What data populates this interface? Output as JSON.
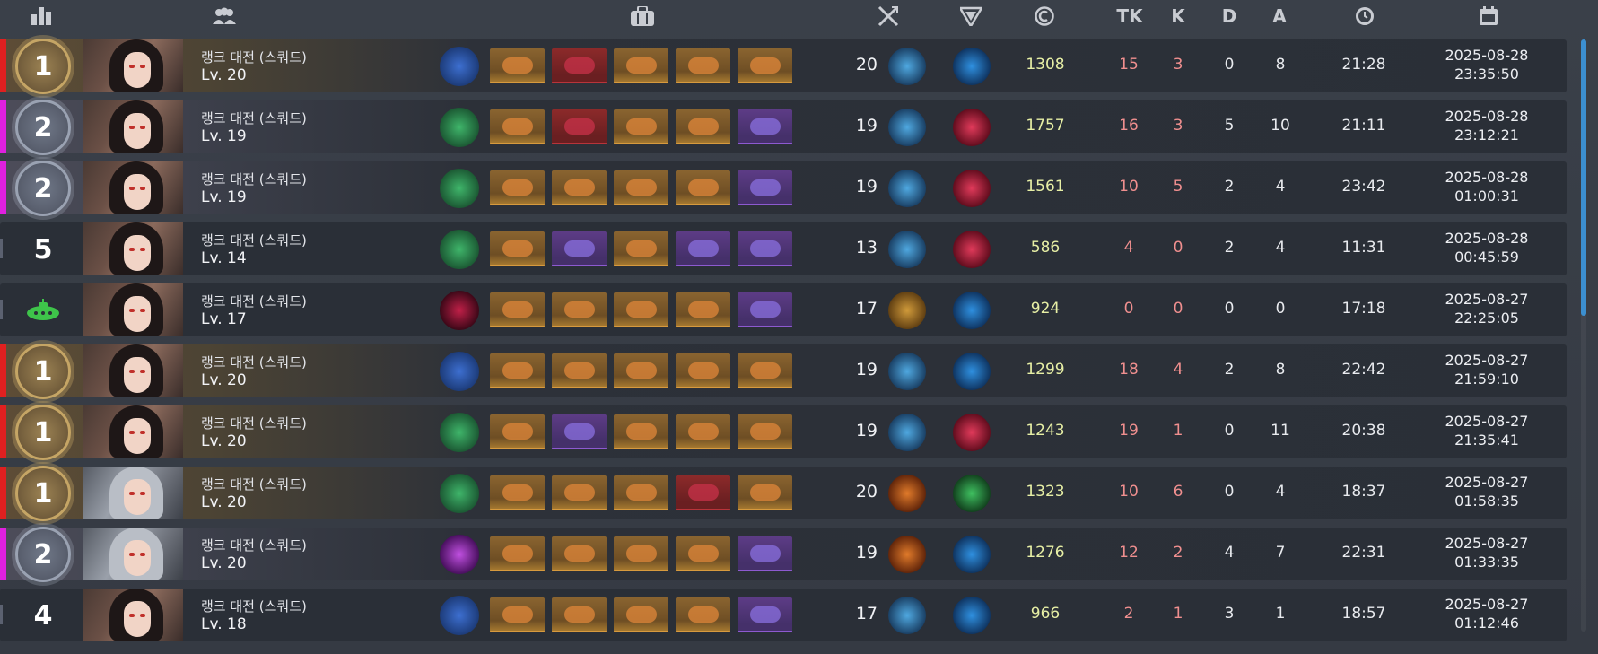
{
  "colors": {
    "rank1": "#e02020",
    "rank2": "#e020e0",
    "rankOther": "#5b6170",
    "score": "#e7efa5",
    "kills": "#f08f8f",
    "accent": "#3c8fd0"
  },
  "header": {
    "icons": [
      "rank-chart-icon",
      "team-icon",
      "inventory-bag-icon",
      "crossed-swords-icon",
      "tactical-shield-icon",
      "credit-icon",
      "clock-icon",
      "calendar-icon"
    ],
    "tk": "TK",
    "k": "K",
    "d": "D",
    "a": "A"
  },
  "rows": [
    {
      "rank": "1",
      "mode": "랭크 대전 (스쿼드)",
      "level": "Lv. 20",
      "lvl2": "20",
      "score": "1308",
      "tk": "15",
      "k": "3",
      "d": "0",
      "a": "8",
      "duration": "21:28",
      "date": "2025-08-28",
      "time": "23:35:50",
      "items": [
        "orange",
        "red",
        "orange",
        "orange",
        "orange"
      ]
    },
    {
      "rank": "2",
      "mode": "랭크 대전 (스쿼드)",
      "level": "Lv. 19",
      "lvl2": "19",
      "score": "1757",
      "tk": "16",
      "k": "3",
      "d": "5",
      "a": "10",
      "duration": "21:11",
      "date": "2025-08-28",
      "time": "23:12:21",
      "items": [
        "orange",
        "red",
        "orange",
        "orange",
        "purple"
      ]
    },
    {
      "rank": "2",
      "mode": "랭크 대전 (스쿼드)",
      "level": "Lv. 19",
      "lvl2": "19",
      "score": "1561",
      "tk": "10",
      "k": "5",
      "d": "2",
      "a": "4",
      "duration": "23:42",
      "date": "2025-08-28",
      "time": "01:00:31",
      "items": [
        "orange",
        "orange",
        "orange",
        "orange",
        "purple"
      ]
    },
    {
      "rank": "5",
      "mode": "랭크 대전 (스쿼드)",
      "level": "Lv. 14",
      "lvl2": "13",
      "score": "586",
      "tk": "4",
      "k": "0",
      "d": "2",
      "a": "4",
      "duration": "11:31",
      "date": "2025-08-28",
      "time": "00:45:59",
      "items": [
        "orange",
        "purple",
        "orange",
        "purple",
        "purple"
      ]
    },
    {
      "rank": "sub",
      "mode": "랭크 대전 (스쿼드)",
      "level": "Lv. 17",
      "lvl2": "17",
      "score": "924",
      "tk": "0",
      "k": "0",
      "d": "0",
      "a": "0",
      "duration": "17:18",
      "date": "2025-08-27",
      "time": "22:25:05",
      "items": [
        "orange",
        "orange",
        "orange",
        "orange",
        "purple"
      ]
    },
    {
      "rank": "1",
      "mode": "랭크 대전 (스쿼드)",
      "level": "Lv. 20",
      "lvl2": "19",
      "score": "1299",
      "tk": "18",
      "k": "4",
      "d": "2",
      "a": "8",
      "duration": "22:42",
      "date": "2025-08-27",
      "time": "21:59:10",
      "items": [
        "orange",
        "orange",
        "orange",
        "orange",
        "orange"
      ]
    },
    {
      "rank": "1",
      "mode": "랭크 대전 (스쿼드)",
      "level": "Lv. 20",
      "lvl2": "19",
      "score": "1243",
      "tk": "19",
      "k": "1",
      "d": "0",
      "a": "11",
      "duration": "20:38",
      "date": "2025-08-27",
      "time": "21:35:41",
      "items": [
        "orange",
        "purple",
        "orange",
        "orange",
        "orange"
      ]
    },
    {
      "rank": "1",
      "mode": "랭크 대전 (스쿼드)",
      "level": "Lv. 20",
      "lvl2": "20",
      "score": "1323",
      "tk": "10",
      "k": "6",
      "d": "0",
      "a": "4",
      "duration": "18:37",
      "date": "2025-08-27",
      "time": "01:58:35",
      "items": [
        "orange",
        "orange",
        "orange",
        "red",
        "orange"
      ]
    },
    {
      "rank": "2",
      "mode": "랭크 대전 (스쿼드)",
      "level": "Lv. 20",
      "lvl2": "19",
      "score": "1276",
      "tk": "12",
      "k": "2",
      "d": "4",
      "a": "7",
      "duration": "22:31",
      "date": "2025-08-27",
      "time": "01:33:35",
      "items": [
        "orange",
        "orange",
        "orange",
        "orange",
        "purple"
      ]
    },
    {
      "rank": "4",
      "mode": "랭크 대전 (스쿼드)",
      "level": "Lv. 18",
      "lvl2": "17",
      "score": "966",
      "tk": "2",
      "k": "1",
      "d": "3",
      "a": "1",
      "duration": "18:57",
      "date": "2025-08-27",
      "time": "01:12:46",
      "items": [
        "orange",
        "orange",
        "orange",
        "orange",
        "purple"
      ]
    }
  ]
}
